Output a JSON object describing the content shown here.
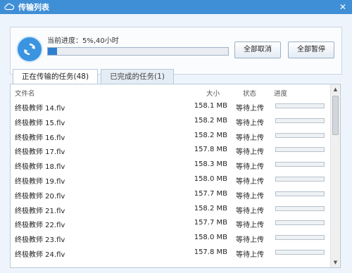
{
  "window": {
    "title": "传输列表",
    "icons": {
      "app": "cloud-icon",
      "close": "close-icon",
      "sync": "sync-icon"
    }
  },
  "progress": {
    "label": "当前进度：5%,40小时",
    "fraction": 0.05,
    "fill_color": "#2f7fd0"
  },
  "buttons": {
    "cancel_all": "全部取消",
    "pause_all": "全部暂停"
  },
  "tabs": [
    {
      "label": "正在传输的任务(48)",
      "active": true
    },
    {
      "label": "已完成的任务(1)",
      "active": false
    }
  ],
  "table": {
    "headers": {
      "name": "文件名",
      "size": "大小",
      "status": "状态",
      "progress": "进度"
    },
    "rows": [
      {
        "name": "终极教师 14.flv",
        "size": "158.1 MB",
        "status": "等待上传",
        "progress": 0
      },
      {
        "name": "终极教师 15.flv",
        "size": "158.2 MB",
        "status": "等待上传",
        "progress": 0
      },
      {
        "name": "终极教师 16.flv",
        "size": "158.2 MB",
        "status": "等待上传",
        "progress": 0
      },
      {
        "name": "终极教师 17.flv",
        "size": "157.8 MB",
        "status": "等待上传",
        "progress": 0
      },
      {
        "name": "终极教师 18.flv",
        "size": "158.3 MB",
        "status": "等待上传",
        "progress": 0
      },
      {
        "name": "终极教师 19.flv",
        "size": "158.0 MB",
        "status": "等待上传",
        "progress": 0
      },
      {
        "name": "终极教师 20.flv",
        "size": "157.7 MB",
        "status": "等待上传",
        "progress": 0
      },
      {
        "name": "终极教师 21.flv",
        "size": "158.2 MB",
        "status": "等待上传",
        "progress": 0
      },
      {
        "name": "终极教师 22.flv",
        "size": "157.7 MB",
        "status": "等待上传",
        "progress": 0
      },
      {
        "name": "终极教师 23.flv",
        "size": "158.0 MB",
        "status": "等待上传",
        "progress": 0
      },
      {
        "name": "终极教师 24.flv",
        "size": "157.8 MB",
        "status": "等待上传",
        "progress": 0
      }
    ]
  }
}
